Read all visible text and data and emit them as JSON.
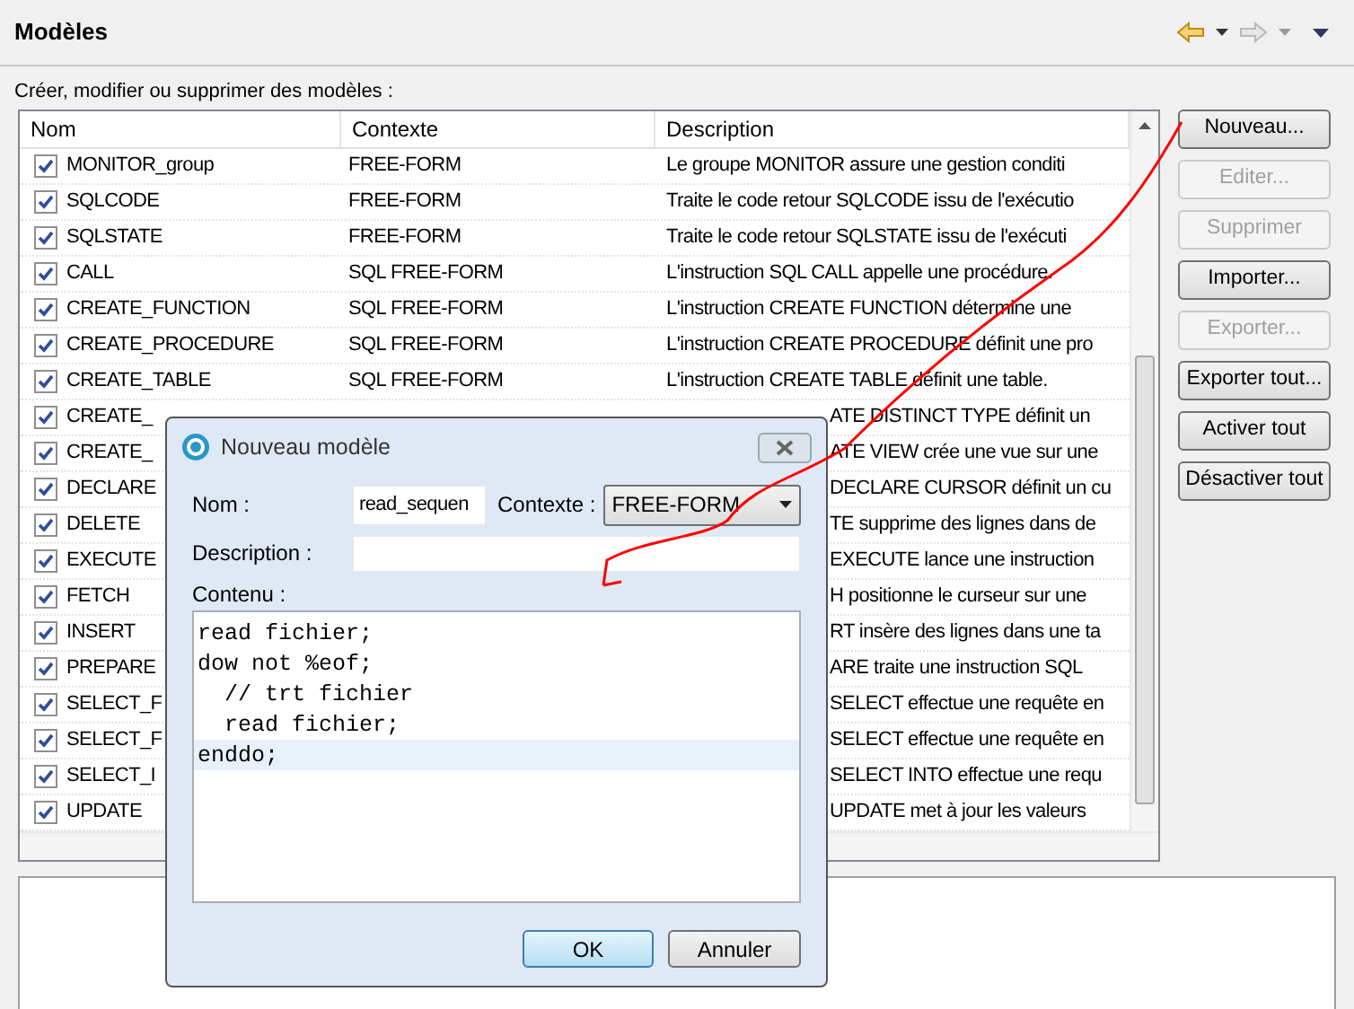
{
  "view": {
    "title": "Modèles",
    "subtitle": "Créer, modifier ou supprimer des modèles :"
  },
  "table": {
    "columns": [
      "Nom",
      "Contexte",
      "Description"
    ],
    "rows": [
      {
        "checked": true,
        "name": "MONITOR_group",
        "context": "FREE-FORM",
        "description": "Le groupe MONITOR assure une gestion conditi"
      },
      {
        "checked": true,
        "name": "SQLCODE",
        "context": "FREE-FORM",
        "description": "Traite le code retour SQLCODE issu de l'exécutio"
      },
      {
        "checked": true,
        "name": "SQLSTATE",
        "context": "FREE-FORM",
        "description": "Traite le code retour SQLSTATE issu de l'exécuti"
      },
      {
        "checked": true,
        "name": "CALL",
        "context": "SQL FREE-FORM",
        "description": "L'instruction SQL CALL appelle une procédure."
      },
      {
        "checked": true,
        "name": "CREATE_FUNCTION",
        "context": "SQL FREE-FORM",
        "description": "L'instruction CREATE FUNCTION détermine une"
      },
      {
        "checked": true,
        "name": "CREATE_PROCEDURE",
        "context": "SQL FREE-FORM",
        "description": "L'instruction CREATE PROCEDURE définit une pro"
      },
      {
        "checked": true,
        "name": "CREATE_TABLE",
        "context": "SQL FREE-FORM",
        "description": "L'instruction CREATE TABLE définit une table."
      },
      {
        "checked": true,
        "name": "CREATE_",
        "description": "ATE DISTINCT TYPE définit un"
      },
      {
        "checked": true,
        "name": "CREATE_",
        "description": "ATE VIEW crée une vue sur une"
      },
      {
        "checked": true,
        "name": "DECLARE",
        "description": "DECLARE CURSOR définit un cu"
      },
      {
        "checked": true,
        "name": "DELETE",
        "description": "TE supprime des lignes dans de"
      },
      {
        "checked": true,
        "name": "EXECUTE",
        "description": "EXECUTE lance une instruction"
      },
      {
        "checked": true,
        "name": "FETCH",
        "description": "H positionne le curseur sur une"
      },
      {
        "checked": true,
        "name": "INSERT",
        "description": "RT insère des lignes dans une ta"
      },
      {
        "checked": true,
        "name": "PREPARE",
        "description": "ARE traite une instruction SQL"
      },
      {
        "checked": true,
        "name": "SELECT_F",
        "description": "SELECT effectue une requête en"
      },
      {
        "checked": true,
        "name": "SELECT_F",
        "description": "SELECT effectue une requête en"
      },
      {
        "checked": true,
        "name": "SELECT_I",
        "description": "SELECT INTO effectue une requ"
      },
      {
        "checked": true,
        "name": "UPDATE",
        "description": "UPDATE met à jour les valeurs"
      }
    ]
  },
  "buttons": [
    {
      "label": "Nouveau...",
      "disabled": false
    },
    {
      "label": "Editer...",
      "disabled": true
    },
    {
      "label": "Supprimer",
      "disabled": true
    },
    {
      "label": "Importer...",
      "disabled": false
    },
    {
      "label": "Exporter...",
      "disabled": true
    },
    {
      "label": "Exporter tout...",
      "disabled": false
    },
    {
      "label": "Activer tout",
      "disabled": false
    },
    {
      "label": "Désactiver tout",
      "disabled": false
    }
  ],
  "dialog": {
    "title": "Nouveau modèle",
    "name_label": "Nom :",
    "name_value": "read_sequen",
    "context_label": "Contexte :",
    "context_value": "FREE-FORM",
    "description_label": "Description :",
    "content_label": "Contenu :",
    "content_lines": [
      {
        "text": "read fichier;",
        "selected": false
      },
      {
        "text": "dow not %eof;",
        "selected": false
      },
      {
        "text": "  // trt fichier",
        "selected": false
      },
      {
        "text": "  read fichier;",
        "selected": false
      },
      {
        "text": "enddo;",
        "selected": true
      }
    ],
    "ok": "OK",
    "cancel": "Annuler"
  }
}
